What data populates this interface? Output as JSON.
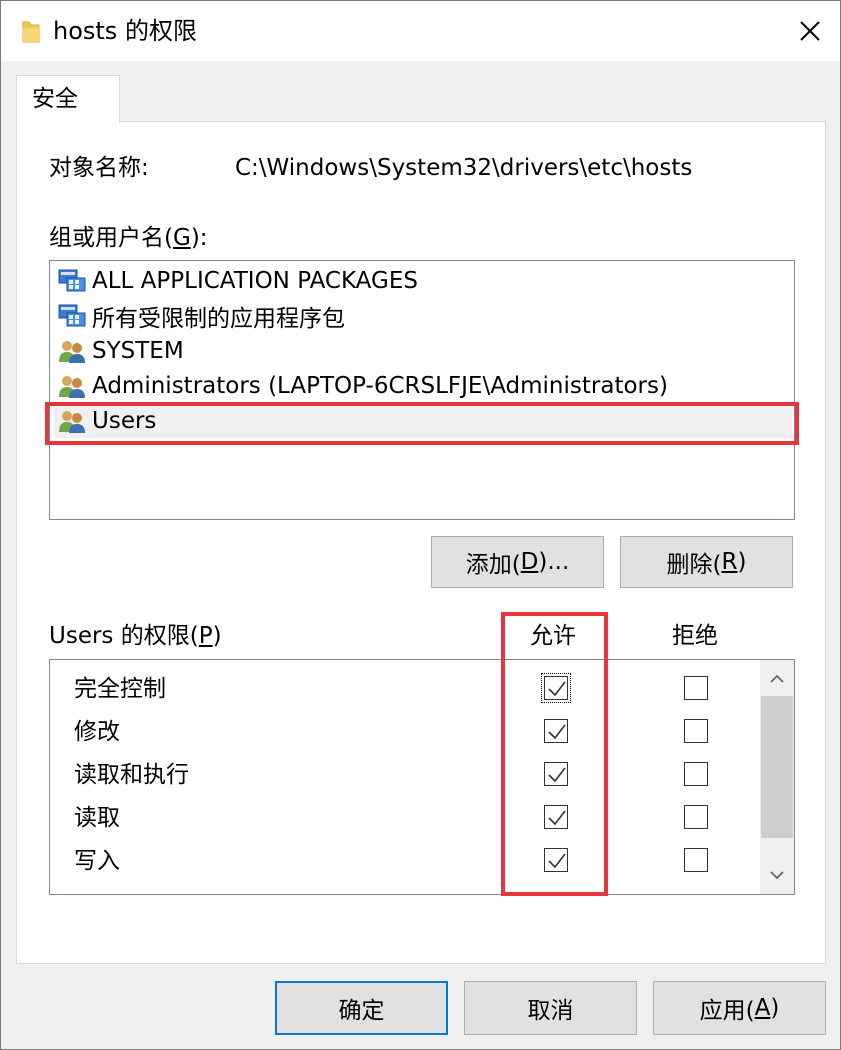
{
  "window": {
    "title": "hosts 的权限",
    "close_icon": "close-icon"
  },
  "tab": {
    "label": "安全"
  },
  "object": {
    "label": "对象名称:",
    "value": "C:\\Windows\\System32\\drivers\\etc\\hosts"
  },
  "groups": {
    "label_prefix": "组或用户名(",
    "label_key": "G",
    "label_suffix": "):",
    "items": [
      {
        "name": "ALL APPLICATION PACKAGES",
        "icon": "package-group-icon"
      },
      {
        "name": "所有受限制的应用程序包",
        "icon": "package-group-icon"
      },
      {
        "name": "SYSTEM",
        "icon": "user-group-icon"
      },
      {
        "name": "Administrators (LAPTOP-6CRSLFJE\\Administrators)",
        "icon": "user-group-icon"
      },
      {
        "name": "Users",
        "icon": "user-group-icon",
        "selected": true
      }
    ]
  },
  "group_buttons": {
    "add_prefix": "添加(",
    "add_key": "D",
    "add_suffix": ")...",
    "remove_prefix": "删除(",
    "remove_key": "R",
    "remove_suffix": ")"
  },
  "permissions": {
    "label_prefix": "Users 的权限(",
    "label_key": "P",
    "label_suffix": ")",
    "allow_header": "允许",
    "deny_header": "拒绝",
    "rows": [
      {
        "name": "完全控制",
        "allow": true,
        "deny": false
      },
      {
        "name": "修改",
        "allow": true,
        "deny": false
      },
      {
        "name": "读取和执行",
        "allow": true,
        "deny": false
      },
      {
        "name": "读取",
        "allow": true,
        "deny": false
      },
      {
        "name": "写入",
        "allow": true,
        "deny": false
      }
    ]
  },
  "footer": {
    "ok": "确定",
    "cancel": "取消",
    "apply_prefix": "应用(",
    "apply_key": "A",
    "apply_suffix": ")"
  },
  "colors": {
    "highlight": "#e8343c",
    "accent": "#0078d7"
  }
}
